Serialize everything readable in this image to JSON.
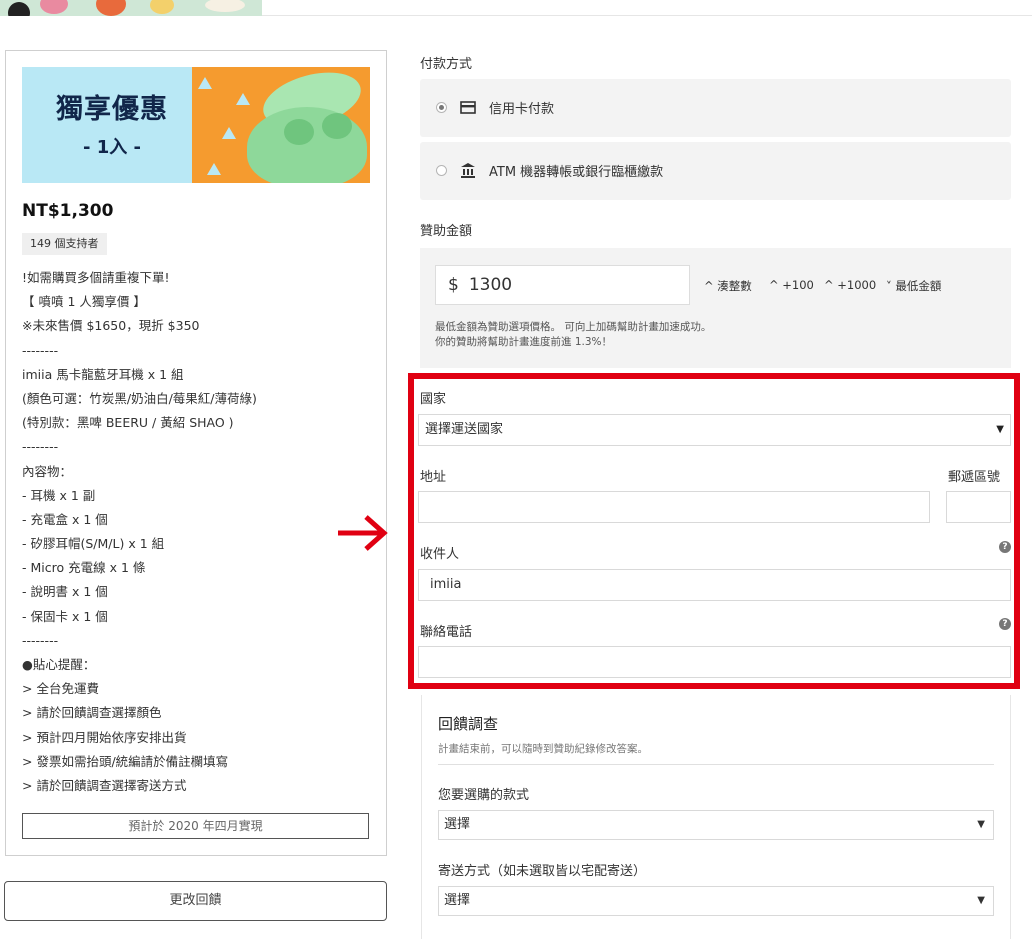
{
  "reward": {
    "promo_title": "獨享優惠",
    "promo_sub": "- 1入 -",
    "price": "NT$1,300",
    "backers": "149 個支持者",
    "description": [
      "!如需購買多個請重複下單!",
      "【 噴噴 1 人獨享價 】",
      "※未來售價 $1650，現折 $350",
      "--------",
      "imiia 馬卡龍藍牙耳機 x 1 組",
      "(顏色可選：竹炭黑/奶油白/莓果紅/薄荷綠)",
      "(特別款：黑啤 BEERU / 黃紹 SHAO )",
      "--------",
      "內容物：",
      "- 耳機 x 1 副",
      "- 充電盒 x 1 個",
      "- 矽膠耳帽(S/M/L) x 1 組",
      "- Micro 充電線 x 1 條",
      "- 說明書 x 1 個",
      "- 保固卡 x 1 個",
      "--------",
      "●貼心提醒：",
      "> 全台免運費",
      "> 請於回饋調查選擇顏色",
      "> 預計四月開始依序安排出貨",
      "> 發票如需抬頭/統編請於備註欄填寫",
      "> 請於回饋調查選擇寄送方式"
    ],
    "eta": "預計於 2020 年四月實現",
    "change_label": "更改回饋"
  },
  "payment": {
    "label": "付款方式",
    "options": [
      {
        "label": "信用卡付款",
        "icon": "credit-card-icon",
        "selected": true
      },
      {
        "label": "ATM 機器轉帳或銀行臨櫃繳款",
        "icon": "bank-icon",
        "selected": false
      }
    ]
  },
  "amount": {
    "label": "贊助金額",
    "currency": "$",
    "value": "1300",
    "adjusters": [
      "^ 湊整數",
      "^ +100",
      "^ +1000",
      "˅ 最低金額"
    ],
    "note_line1": "最低金額為贊助選項價格。 可向上加碼幫助計畫加速成功。",
    "note_line2": "你的贊助將幫助計畫進度前進 1.3%！"
  },
  "shipping": {
    "country_label": "國家",
    "country_value": "選擇運送國家",
    "address_label": "地址",
    "address_value": "",
    "zip_label": "郵遞區號",
    "zip_value": "",
    "recipient_label": "收件人",
    "recipient_value": "imiia",
    "phone_label": "聯絡電話",
    "phone_value": "",
    "help_glyph": "?",
    "caret": "▼"
  },
  "survey": {
    "title": "回饋調查",
    "subtitle": "計畫結束前，可以隨時到贊助紀錄修改答案。",
    "questions": [
      {
        "label": "您要選購的款式",
        "value": "選擇"
      },
      {
        "label": "寄送方式（如未選取皆以宅配寄送）",
        "value": "選擇"
      }
    ]
  },
  "colors": {
    "highlight": "#e00012",
    "promo_orange": "#f59b2f",
    "promo_blue": "#b9e8f5"
  }
}
